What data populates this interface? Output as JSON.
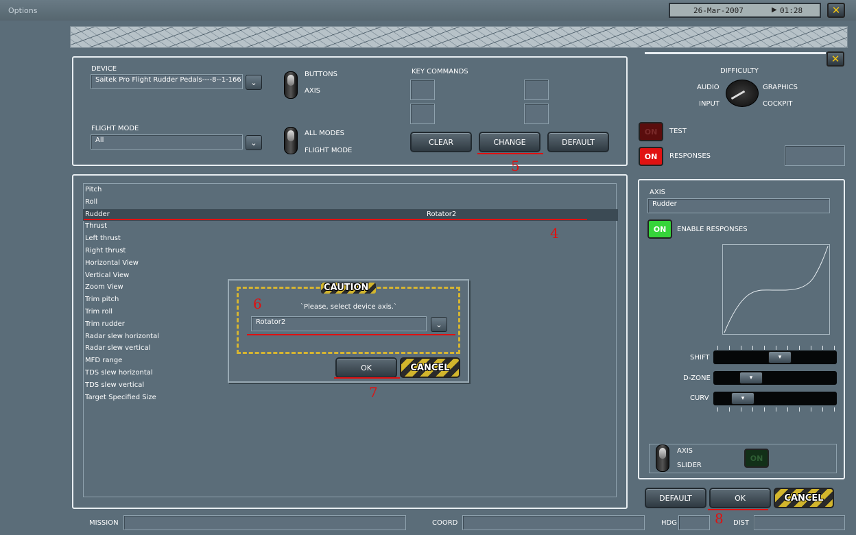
{
  "window": {
    "title": "Options",
    "date": "26-Mar-2007",
    "time": "01:28"
  },
  "device_panel": {
    "device_label": "DEVICE",
    "device_value": "Saitek Pro Flight Rudder Pedals----8--1-166",
    "buttons_label": "BUTTONS",
    "axis_label": "AXIS",
    "flight_mode_label": "FLIGHT MODE",
    "flight_mode_value": "All",
    "all_modes_label": "ALL MODES",
    "flight_mode_toggle_label": "FLIGHT MODE",
    "key_commands_label": "KEY COMMANDS",
    "clear_label": "CLEAR",
    "change_label": "CHANGE",
    "default_label": "DEFAULT"
  },
  "command_list": {
    "items": [
      {
        "name": "Pitch",
        "value": ""
      },
      {
        "name": "Roll",
        "value": ""
      },
      {
        "name": "Rudder",
        "value": "Rotator2"
      },
      {
        "name": "Thrust",
        "value": ""
      },
      {
        "name": "Left thrust",
        "value": ""
      },
      {
        "name": "Right thrust",
        "value": ""
      },
      {
        "name": "Horizontal View",
        "value": ""
      },
      {
        "name": "Vertical View",
        "value": ""
      },
      {
        "name": "Zoom View",
        "value": ""
      },
      {
        "name": "Trim pitch",
        "value": ""
      },
      {
        "name": "Trim roll",
        "value": ""
      },
      {
        "name": "Trim rudder",
        "value": ""
      },
      {
        "name": "Radar slew horizontal",
        "value": ""
      },
      {
        "name": "Radar slew vertical",
        "value": ""
      },
      {
        "name": "MFD range",
        "value": ""
      },
      {
        "name": "TDS slew horizontal",
        "value": ""
      },
      {
        "name": "TDS slew vertical",
        "value": ""
      },
      {
        "name": "Target Specified Size",
        "value": ""
      }
    ]
  },
  "dialog": {
    "title": "CAUTION",
    "message": "`Please, select device axis.`",
    "selected_axis": "Rotator2",
    "ok_label": "OK",
    "cancel_label": "CANCEL"
  },
  "settings_menu": {
    "difficulty": "DIFFICULTY",
    "audio": "AUDIO",
    "graphics": "GRAPHICS",
    "input": "INPUT",
    "cockpit": "COCKPIT",
    "test_on": "ON",
    "test_label": "TEST",
    "responses_on": "ON",
    "responses_label": "RESPONSES"
  },
  "axis_panel": {
    "axis_label": "AXIS",
    "axis_value": "Rudder",
    "enable_on": "ON",
    "enable_label": "ENABLE RESPONSES",
    "shift_label": "SHIFT",
    "dzone_label": "D-ZONE",
    "curv_label": "CURV",
    "shift_level": 0.55,
    "dzone_level": 0.26,
    "curv_level": 0.18,
    "axis_toggle_label": "AXIS",
    "slider_toggle_label": "SLIDER",
    "slider_on": "ON"
  },
  "footer": {
    "default_label": "DEFAULT",
    "ok_label": "OK",
    "cancel_label": "CANCEL",
    "mission_label": "MISSION",
    "coord_label": "COORD",
    "hdg_label": "HDG",
    "dist_label": "DIST"
  },
  "annotations": [
    "4",
    "5",
    "6",
    "7",
    "8"
  ]
}
